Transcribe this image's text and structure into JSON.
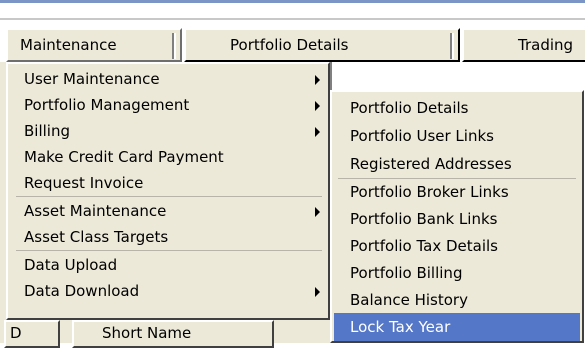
{
  "menubar": {
    "tabs": [
      {
        "label": "Maintenance"
      },
      {
        "label": "Portfolio Details"
      },
      {
        "label": "Trading"
      }
    ]
  },
  "maintenance_menu": {
    "items": [
      {
        "label": "User Maintenance",
        "has_submenu": true
      },
      {
        "label": "Portfolio Management",
        "has_submenu": true
      },
      {
        "label": "Billing",
        "has_submenu": true
      },
      {
        "label": "Make Credit Card Payment",
        "has_submenu": false
      },
      {
        "label": "Request Invoice",
        "has_submenu": false
      },
      {
        "label": "Asset Maintenance",
        "has_submenu": true
      },
      {
        "label": "Asset Class Targets",
        "has_submenu": false
      },
      {
        "label": "Data Upload",
        "has_submenu": false
      },
      {
        "label": "Data Download",
        "has_submenu": true
      }
    ]
  },
  "portfolio_submenu": {
    "items": [
      {
        "label": "Portfolio Details"
      },
      {
        "label": "Portfolio User Links"
      },
      {
        "label": "Registered Addresses"
      },
      {
        "label": "Portfolio Broker Links"
      },
      {
        "label": "Portfolio Bank Links"
      },
      {
        "label": "Portfolio Tax Details"
      },
      {
        "label": "Portfolio Billing"
      },
      {
        "label": "Balance History"
      },
      {
        "label": "Lock Tax Year",
        "selected": true
      }
    ]
  },
  "grid_headers": [
    {
      "label": "D"
    },
    {
      "label": "Short Name"
    }
  ],
  "colors": {
    "menu_background": "#ece9d8",
    "selection_highlight": "#5577c8"
  }
}
